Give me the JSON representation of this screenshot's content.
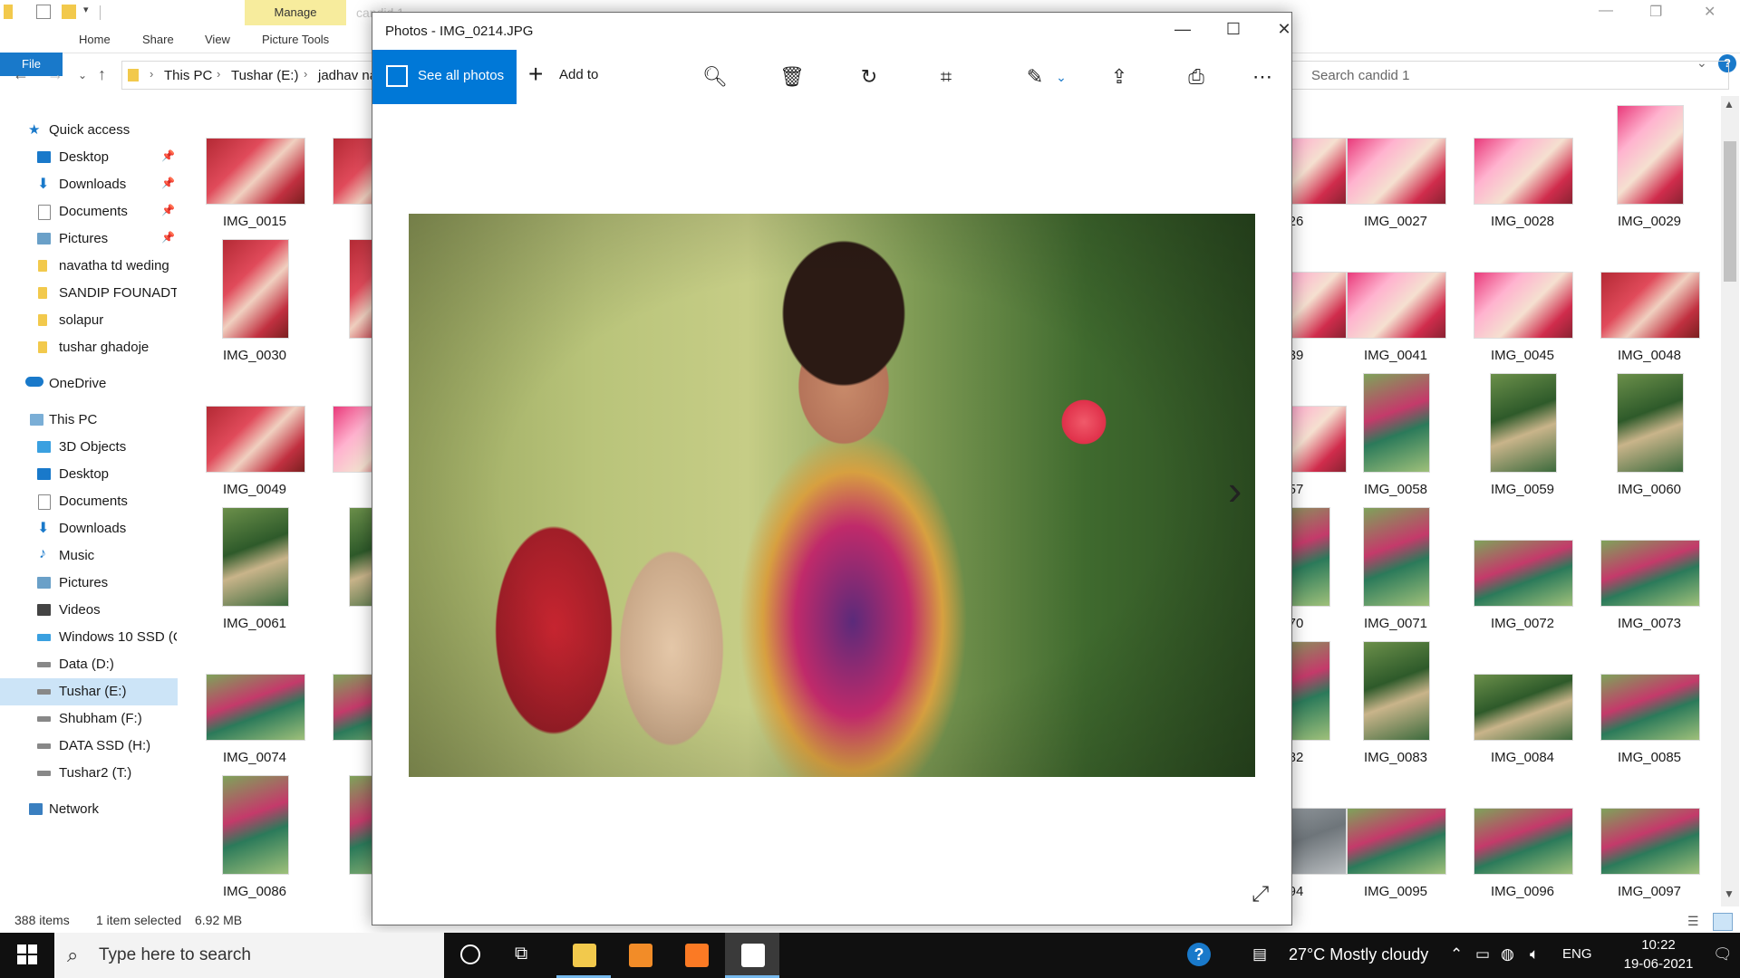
{
  "explorer": {
    "title_faded": "candid 1",
    "ribbon": {
      "file_tab": "File",
      "tabs": [
        "Home",
        "Share",
        "View",
        "Picture Tools"
      ],
      "context_tab": "Manage"
    },
    "address": {
      "crumbs": [
        "This PC",
        "Tushar (E:)",
        "jadhav na"
      ]
    },
    "search_placeholder": "Search candid 1",
    "sidebar": {
      "quick_access": "Quick access",
      "quick_items": [
        "Desktop",
        "Downloads",
        "Documents",
        "Pictures",
        "navatha td weding",
        "SANDIP FOUNADTIO",
        "solapur",
        "tushar ghadoje"
      ],
      "onedrive": "OneDrive",
      "this_pc": "This PC",
      "pc_items": [
        "3D Objects",
        "Desktop",
        "Documents",
        "Downloads",
        "Music",
        "Pictures",
        "Videos",
        "Windows 10 SSD (C",
        "Data (D:)",
        "Tushar (E:)",
        "Shubham (F:)",
        "DATA SSD (H:)",
        "Tushar2 (T:)"
      ],
      "network": "Network"
    },
    "thumbnails_left": [
      [
        "IMG_0015",
        "IM"
      ],
      [
        "IMG_0030",
        "IM"
      ],
      [
        "IMG_0049",
        "IM"
      ],
      [
        "IMG_0061",
        "IM"
      ],
      [
        "IMG_0074",
        "IM"
      ],
      [
        "IMG_0086",
        "IM"
      ]
    ],
    "thumbnails_right": [
      [
        "26",
        "IMG_0027",
        "IMG_0028",
        "IMG_0029"
      ],
      [
        "39",
        "IMG_0041",
        "IMG_0045",
        "IMG_0048"
      ],
      [
        "57",
        "IMG_0058",
        "IMG_0059",
        "IMG_0060"
      ],
      [
        "70",
        "IMG_0071",
        "IMG_0072",
        "IMG_0073"
      ],
      [
        "82",
        "IMG_0083",
        "IMG_0084",
        "IMG_0085"
      ],
      [
        "94",
        "IMG_0095",
        "IMG_0096",
        "IMG_0097"
      ]
    ],
    "status": {
      "item_count": "388 items",
      "selection": "1 item selected",
      "size": "6.92 MB"
    }
  },
  "photos": {
    "title": "Photos - IMG_0214.JPG",
    "see_all_photos": "See all photos",
    "add_to": "Add to",
    "toolbar_icons": [
      "zoom-in-icon",
      "delete-icon",
      "rotate-icon",
      "crop-icon",
      "edit-icon",
      "share-icon",
      "print-icon",
      "more-icon"
    ]
  },
  "taskbar": {
    "search_placeholder": "Type here to search",
    "weather": "27°C  Mostly cloudy",
    "language": "ENG",
    "time": "10:22",
    "date": "19-06-2021"
  }
}
